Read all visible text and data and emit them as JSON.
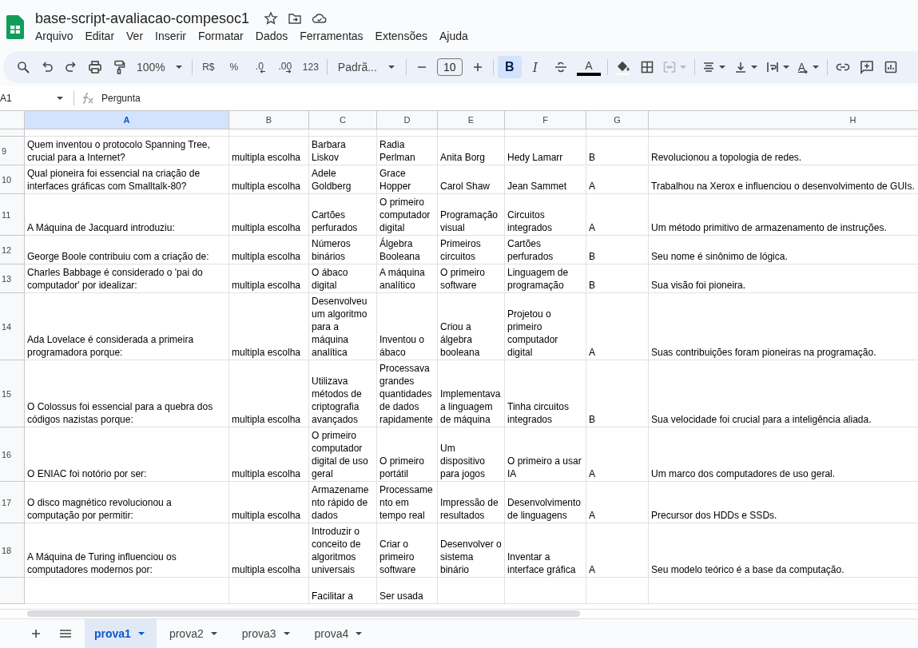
{
  "document": {
    "title": "base-script-avaliacao-compesoc1"
  },
  "menu": [
    "Arquivo",
    "Editar",
    "Ver",
    "Inserir",
    "Formatar",
    "Dados",
    "Ferramentas",
    "Extensões",
    "Ajuda"
  ],
  "toolbar": {
    "zoom": "100%",
    "number_buttons": [
      "R$",
      "%",
      ".0",
      ".00",
      "123"
    ],
    "font": "Padrã...",
    "font_size": "10",
    "format_buttons": [
      {
        "kind": "bold",
        "label": "B",
        "selected": true
      },
      {
        "kind": "italic",
        "label": "I",
        "selected": false
      },
      {
        "kind": "strike",
        "selected": false
      },
      {
        "kind": "text-color",
        "label": "A",
        "selected": false
      }
    ],
    "merge": {
      "disabled": true
    },
    "rotation": {
      "label": "A"
    }
  },
  "name_box": "A1",
  "formula": "Pergunta",
  "columns": [
    {
      "label": "A",
      "selected": true
    },
    {
      "label": "B",
      "selected": false
    },
    {
      "label": "C",
      "selected": false
    },
    {
      "label": "D",
      "selected": false
    },
    {
      "label": "E",
      "selected": false
    },
    {
      "label": "F",
      "selected": false
    },
    {
      "label": "G",
      "selected": false
    },
    {
      "label": "H",
      "selected": false
    }
  ],
  "rows": [
    {
      "number": "9",
      "cells": {
        "A": "Quem inventou o protocolo Spanning Tree, crucial para a Internet?",
        "B": "multipla escolha",
        "C": "Barbara Liskov",
        "D": "Radia Perlman",
        "E": "Anita Borg",
        "F": "Hedy Lamarr",
        "G": "B",
        "H": "Revolucionou a topologia de redes."
      }
    },
    {
      "number": "10",
      "cells": {
        "A": "Qual pioneira foi essencial na criação de interfaces gráficas com Smalltalk-80?",
        "B": "multipla escolha",
        "C": "Adele Goldberg",
        "D": "Grace Hopper",
        "E": "Carol Shaw",
        "F": "Jean Sammet",
        "G": "A",
        "H": "Trabalhou na Xerox e influenciou o desenvolvimento de GUIs."
      }
    },
    {
      "number": "11",
      "cells": {
        "A": "A Máquina de Jacquard introduziu:",
        "B": "multipla escolha",
        "C": "Cartões perfurados",
        "D": "O primeiro computador digital",
        "E": "Programação visual",
        "F": "Circuitos integrados",
        "G": "A",
        "H": "Um método primitivo de armazenamento de instruções."
      }
    },
    {
      "number": "12",
      "cells": {
        "A": "George Boole contribuiu com a criação de:",
        "B": "multipla escolha",
        "C": "Números binários",
        "D": "Álgebra Booleana",
        "E": "Primeiros circuitos",
        "F": "Cartões perfurados",
        "G": "B",
        "H": "Seu nome é sinônimo de lógica."
      }
    },
    {
      "number": "13",
      "cells": {
        "A": "Charles Babbage é considerado o 'pai do computador' por idealizar:",
        "B": "multipla escolha",
        "C": "O ábaco digital",
        "D": "A máquina analítico",
        "E": "O primeiro software",
        "F": "Linguagem de programação",
        "G": "B",
        "H": "Sua visão foi pioneira."
      }
    },
    {
      "number": "14",
      "cells": {
        "A": "Ada Lovelace é considerada a primeira programadora porque:",
        "B": "multipla escolha",
        "C": "Desenvolveu um algoritmo para a máquina analítica",
        "D": "Inventou o ábaco",
        "E": "Criou a álgebra booleana",
        "F": "Projetou o primeiro computador digital",
        "G": "A",
        "H": "Suas contribuições foram pioneiras na programação."
      }
    },
    {
      "number": "15",
      "cells": {
        "A": "O Colossus foi essencial para a quebra dos códigos nazistas porque:",
        "B": "multipla escolha",
        "C": "Utilizava métodos de criptografia avançados",
        "D": "Processava grandes quantidades de dados rapidamente",
        "E": "Implementava a linguagem de máquina",
        "F": "Tinha circuitos integrados",
        "G": "B",
        "H": "Sua velocidade foi crucial para a inteligência aliada."
      }
    },
    {
      "number": "16",
      "cells": {
        "A": "O ENIAC foi notório por ser:",
        "B": "multipla escolha",
        "C": "O primeiro computador digital de uso geral",
        "D": "O primeiro portátil",
        "E": "Um dispositivo para jogos",
        "F": "O primeiro a usar IA",
        "G": "A",
        "H": "Um marco dos computadores de uso geral."
      }
    },
    {
      "number": "17",
      "cells": {
        "A": "O disco magnético revolucionou a computação por permitir:",
        "B": "multipla escolha",
        "C": "Armazenamento rápido de dados",
        "D": "Processamento em tempo real",
        "E": "Impressão de resultados",
        "F": "Desenvolvimento de linguagens",
        "G": "A",
        "H": "Precursor dos HDDs e SSDs."
      }
    },
    {
      "number": "18",
      "cells": {
        "A": "A Máquina de Turing influenciou os computadores modernos por:",
        "B": "multipla escolha",
        "C": "Introduzir o conceito de algoritmos universais",
        "D": "Criar o primeiro software",
        "E": "Desenvolver o sistema binário",
        "F": "Inventar a interface gráfica",
        "G": "A",
        "H": "Seu modelo teórico é a base da computação."
      }
    },
    {
      "cells": {
        "C": "Facilitar a",
        "D": "Ser usada"
      }
    }
  ],
  "sheets": [
    {
      "label": "prova1",
      "selected": true
    },
    {
      "label": "prova2",
      "selected": false
    },
    {
      "label": "prova3",
      "selected": false
    },
    {
      "label": "prova4",
      "selected": false
    }
  ]
}
